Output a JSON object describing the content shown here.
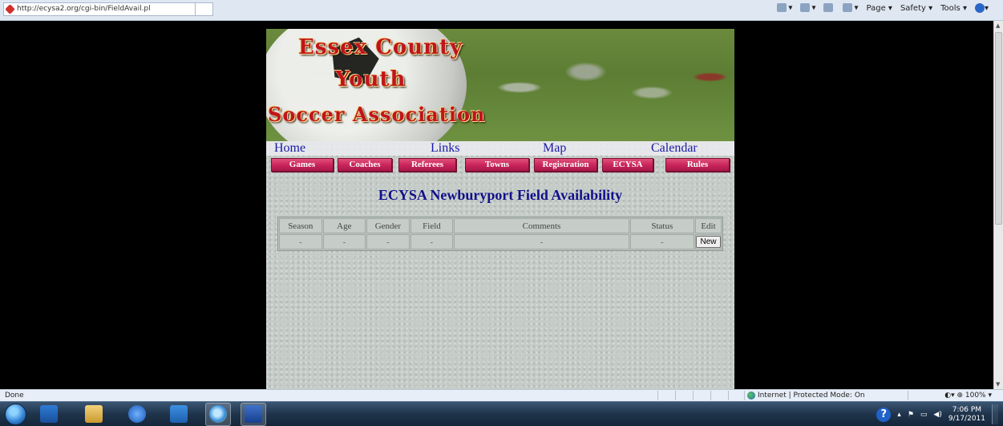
{
  "browser": {
    "url": "http://ecysa2.org/cgi-bin/FieldAvail.pl",
    "commands": [
      "Page ▾",
      "Safety ▾",
      "Tools ▾"
    ]
  },
  "banner": {
    "line1": "Essex County",
    "line2": "Youth",
    "line3": "Soccer Association"
  },
  "nav": {
    "links": [
      "Home",
      "Links",
      "Map",
      "Calendar"
    ],
    "buttons": [
      "Games",
      "Coaches",
      "Referees",
      "Towns",
      "Registration",
      "ECYSA",
      "Rules"
    ]
  },
  "page_title": "ECYSA Newburyport Field Availability",
  "table": {
    "headers": [
      "Season",
      "Age",
      "Gender",
      "Field",
      "Comments",
      "Status",
      "Edit"
    ],
    "row": [
      "-",
      "-",
      "-",
      "-",
      "-",
      "-"
    ],
    "new_label": "New"
  },
  "statusbar": {
    "left": "Done",
    "zone": "Internet | Protected Mode: On",
    "zoom": " 100% ▾"
  },
  "taskbar": {
    "time": "7:06 PM",
    "date": "9/17/2011"
  }
}
